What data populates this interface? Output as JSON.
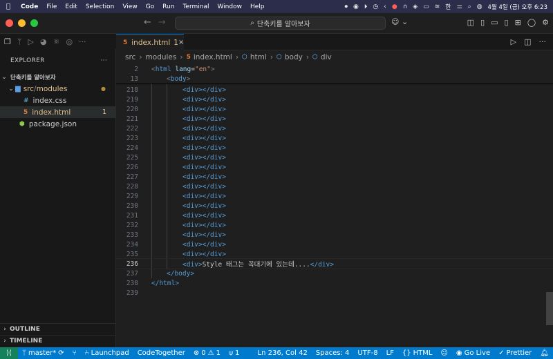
{
  "menubar": {
    "apple": "",
    "items": [
      "Code",
      "File",
      "Edit",
      "Selection",
      "View",
      "Go",
      "Run",
      "Terminal",
      "Window",
      "Help"
    ],
    "input_source": "한",
    "clock": "4월 4일 (금) 오후 6:23"
  },
  "titlebar": {
    "command_center": "단축키를 알아보자"
  },
  "sidebar": {
    "title": "EXPLORER",
    "more": "···",
    "project": "단축키를 알아보자",
    "folder": {
      "part1": "src",
      "slash": "/",
      "part2": "modules"
    },
    "files": [
      {
        "icon": "#",
        "name": "index.css",
        "badge": ""
      },
      {
        "icon": "5",
        "name": "index.html",
        "badge": "1"
      },
      {
        "icon": "⬢",
        "name": "package.json",
        "badge": ""
      }
    ],
    "outline": "OUTLINE",
    "timeline": "TIMELINE"
  },
  "tab": {
    "name": "index.html",
    "badge": "1"
  },
  "breadcrumb": [
    "src",
    "modules",
    "index.html",
    "html",
    "body",
    "div"
  ],
  "editor": {
    "sticky": [
      {
        "n": "2",
        "open": "<",
        "tag": "html",
        "attr": " lang",
        "eq": "=",
        "val": "\"en\"",
        "close": ">"
      },
      {
        "n": "13",
        "open": "<",
        "tag": "body",
        "close": ">"
      }
    ],
    "div_lines": [
      "218",
      "219",
      "220",
      "221",
      "222",
      "223",
      "224",
      "225",
      "226",
      "227",
      "228",
      "229",
      "230",
      "231",
      "232",
      "233",
      "234",
      "235"
    ],
    "div_open": "<div>",
    "div_close": "</div>",
    "current_line": {
      "n": "236",
      "text": "Style 태그는 꼭대기에 있는데...."
    },
    "body_close": {
      "n": "237",
      "text": "</body>"
    },
    "html_close": {
      "n": "238",
      "text": "</html>"
    },
    "last": {
      "n": "239"
    }
  },
  "status": {
    "branch": "master*",
    "launchpad": "Launchpad",
    "codetogether": "CodeTogether",
    "errors": "0",
    "warnings": "1",
    "ports": "1",
    "position": "Ln 236, Col 42",
    "spaces": "Spaces: 4",
    "encoding": "UTF-8",
    "eol": "LF",
    "language": "HTML",
    "golive": "Go Live",
    "prettier": "Prettier"
  }
}
